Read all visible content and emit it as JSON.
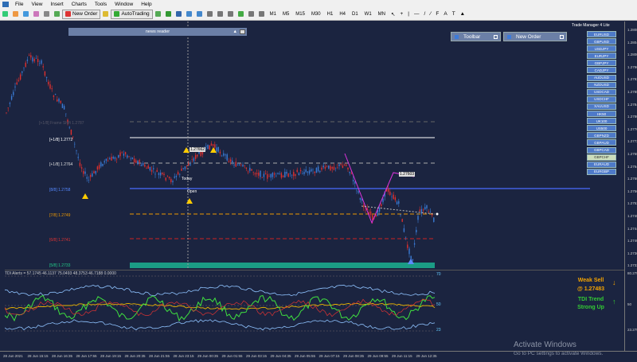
{
  "menu": [
    "File",
    "View",
    "Insert",
    "Charts",
    "Tools",
    "Window",
    "Help"
  ],
  "toolbar": {
    "new_order": "New Order",
    "autotrading": "AutoTrading",
    "timeframes": [
      "M1",
      "M5",
      "M15",
      "M30",
      "H1",
      "H4",
      "D1",
      "W1",
      "MN"
    ]
  },
  "news_reader": {
    "title": "news reader"
  },
  "panels": {
    "toolbar": "Toolbar",
    "new_order": "New Order"
  },
  "trade_manager": {
    "title": "Trade Manager 4 Lite",
    "pairs": [
      "EURUSD",
      "GBPUSD",
      "USDJPY",
      "EURJPY",
      "GBPJPY",
      "CADJPY",
      "AUDUSD",
      "NZDUSD",
      "USDCAD",
      "USDCHF",
      "XAUUSD",
      "HK50",
      "UK100",
      "US500",
      "GBPNZD",
      "GBPAUD",
      "GBPCAD",
      "GBPCHF",
      "EURAUD",
      "EURGBP"
    ],
    "selected": "GBPCHF"
  },
  "levels": {
    "l1": "[+1/8]  1.2772",
    "l2": "[+1/8]  1.2764",
    "l3": "[8/8]  1.2758",
    "l4": "[7/8]  1.2749",
    "l5": "[6/8]  1.2741",
    "l6": "[5/8]  1.2733",
    "hidden": "[+1/8] Frame Shift 1.2787"
  },
  "annotations": {
    "price_box1": "1.27662",
    "price_box2": "1.27603",
    "label_today": "Today",
    "label_open": "Open"
  },
  "indicator": {
    "title": "TDI Alerts = 57.1745 46.1137 75.0493 48.3753 46.7188 0.0000",
    "level_high": "70",
    "level_mid": "50",
    "level_low": "23",
    "signal": "Weak Sell",
    "signal_price": "@ 1.27483",
    "trend": "TDI Trend",
    "strength": "Strong Up"
  },
  "price_axis": [
    "1.28085",
    "1.28045",
    "1.28005",
    "1.27965",
    "1.27925",
    "1.27885",
    "1.27845",
    "1.27805",
    "1.27765",
    "1.27725",
    "1.27685",
    "1.27645",
    "1.27605",
    "1.27565",
    "1.27525",
    "1.27485",
    "1.27445",
    "1.27405",
    "1.27365",
    "1.27325"
  ],
  "ind_axis": [
    "80.2753",
    "50",
    "23.2753"
  ],
  "time_axis": [
    "28 Jun 2021",
    "28 Jun 15:15",
    "28 Jun 16:35",
    "28 Jun 17:55",
    "28 Jun 19:15",
    "28 Jun 20:35",
    "28 Jun 21:55",
    "28 Jun 23:15",
    "29 Jun 00:35",
    "29 Jun 01:55",
    "29 Jun 03:15",
    "29 Jun 04:35",
    "29 Jun 05:55",
    "29 Jun 07:15",
    "29 Jun 08:35",
    "29 Jun 09:55",
    "29 Jun 11:15",
    "29 Jun 12:35"
  ],
  "watermark": {
    "title": "Activate Windows",
    "sub": "Go to PC settings to activate Windows."
  }
}
